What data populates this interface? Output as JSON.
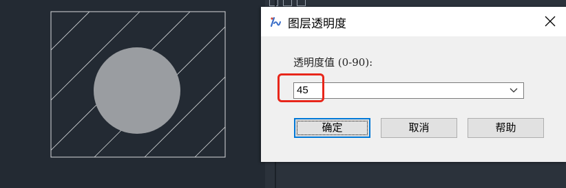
{
  "dialog": {
    "title": "图层透明度",
    "app_icon": "cad-app-icon",
    "close_icon": "close-icon",
    "field_label": "透明度值 (0-90):",
    "transparency_value": "45",
    "dropdown_icon": "chevron-down-icon",
    "buttons": {
      "ok": "确定",
      "cancel": "取消",
      "help": "帮助"
    }
  },
  "colors": {
    "canvas_background": "#232a33",
    "circle_fill": "#9a9da1",
    "hatch_lines": "#d8dadc",
    "highlight": "#e8261a",
    "focus_border": "#0078d7"
  }
}
